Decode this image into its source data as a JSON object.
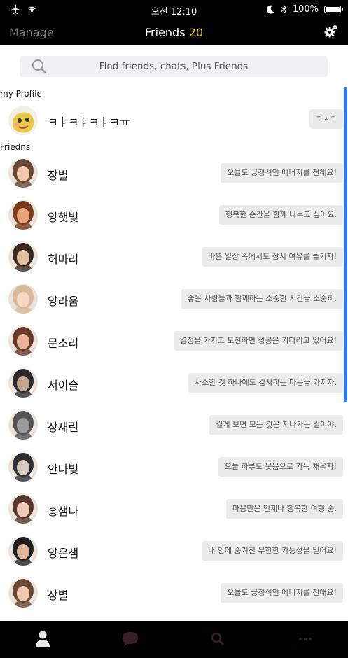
{
  "status_bar": {
    "time": "오전 12:10",
    "battery": "100%",
    "battery_level": 1.0
  },
  "nav": {
    "manage_label": "Manage",
    "title": "Friends",
    "count": "20"
  },
  "search": {
    "placeholder": "Find friends, chats, Plus Friends"
  },
  "profile_section": {
    "label": "my Profile",
    "name": "ㅋㅑㅋㅑㅋㅑㅋㅠ",
    "status": "ㄱㅅㄱ"
  },
  "friends_section": {
    "label": "Friedns",
    "items": [
      {
        "name": "장별",
        "status": "오늘도 긍정적인 에너지를 전해요!"
      },
      {
        "name": "양햇빛",
        "status": "행복한 순간을 함께 나누고 싶어요."
      },
      {
        "name": "허마리",
        "status": "바쁜 일상 속에서도 잠시 여유를 즐기자!"
      },
      {
        "name": "양라움",
        "status": "좋은 사람들과 함께하는 소중한 시간을 소중히."
      },
      {
        "name": "문소리",
        "status": "열정을 가지고 도전하면 성공은 기다리고 있어요!"
      },
      {
        "name": "서이슬",
        "status": "사소한 것 하나에도 감사하는 마음을 가지자."
      },
      {
        "name": "장새린",
        "status": "길게 보면 모든 것은 지나가는 일이야."
      },
      {
        "name": "안나빛",
        "status": "오늘 하루도 웃음으로 가득 채우자!"
      },
      {
        "name": "홍샘나",
        "status": "마음만은 언제나 행복한 여행 중."
      },
      {
        "name": "양은샘",
        "status": "내 안에 숨겨진 무한한 가능성을 믿어요!"
      },
      {
        "name": "장별",
        "status": "오늘도 긍정적인 에너지를 전해요!"
      }
    ]
  },
  "tabs": [
    {
      "icon": "person-icon",
      "active": true
    },
    {
      "icon": "chat-bubble-icon",
      "active": false
    },
    {
      "icon": "search-icon",
      "active": false
    },
    {
      "icon": "more-icon",
      "active": false
    }
  ],
  "colors": {
    "accent": "#f1c232",
    "scrollbar": "#2979ff",
    "tab_inactive": "#3a1f22"
  }
}
